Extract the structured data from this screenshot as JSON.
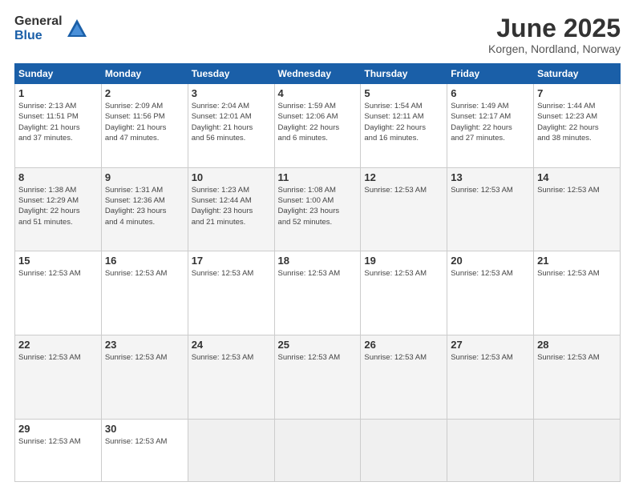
{
  "logo": {
    "general": "General",
    "blue": "Blue"
  },
  "title": "June 2025",
  "subtitle": "Korgen, Nordland, Norway",
  "days_of_week": [
    "Sunday",
    "Monday",
    "Tuesday",
    "Wednesday",
    "Thursday",
    "Friday",
    "Saturday"
  ],
  "weeks": [
    [
      {
        "day": "1",
        "info": "Sunrise: 2:13 AM\nSunset: 11:51 PM\nDaylight: 21 hours\nand 37 minutes."
      },
      {
        "day": "2",
        "info": "Sunrise: 2:09 AM\nSunset: 11:56 PM\nDaylight: 21 hours\nand 47 minutes."
      },
      {
        "day": "3",
        "info": "Sunrise: 2:04 AM\nSunset: 12:01 AM\nDaylight: 21 hours\nand 56 minutes."
      },
      {
        "day": "4",
        "info": "Sunrise: 1:59 AM\nSunset: 12:06 AM\nDaylight: 22 hours\nand 6 minutes."
      },
      {
        "day": "5",
        "info": "Sunrise: 1:54 AM\nSunset: 12:11 AM\nDaylight: 22 hours\nand 16 minutes."
      },
      {
        "day": "6",
        "info": "Sunrise: 1:49 AM\nSunset: 12:17 AM\nDaylight: 22 hours\nand 27 minutes."
      },
      {
        "day": "7",
        "info": "Sunrise: 1:44 AM\nSunset: 12:23 AM\nDaylight: 22 hours\nand 38 minutes."
      }
    ],
    [
      {
        "day": "8",
        "info": "Sunrise: 1:38 AM\nSunset: 12:29 AM\nDaylight: 22 hours\nand 51 minutes."
      },
      {
        "day": "9",
        "info": "Sunrise: 1:31 AM\nSunset: 12:36 AM\nDaylight: 23 hours\nand 4 minutes."
      },
      {
        "day": "10",
        "info": "Sunrise: 1:23 AM\nSunset: 12:44 AM\nDaylight: 23 hours\nand 21 minutes."
      },
      {
        "day": "11",
        "info": "Sunrise: 1:08 AM\nSunset: 1:00 AM\nDaylight: 23 hours\nand 52 minutes."
      },
      {
        "day": "12",
        "info": "Sunrise: 12:53 AM"
      },
      {
        "day": "13",
        "info": "Sunrise: 12:53 AM"
      },
      {
        "day": "14",
        "info": "Sunrise: 12:53 AM"
      }
    ],
    [
      {
        "day": "15",
        "info": "Sunrise: 12:53 AM"
      },
      {
        "day": "16",
        "info": "Sunrise: 12:53 AM"
      },
      {
        "day": "17",
        "info": "Sunrise: 12:53 AM"
      },
      {
        "day": "18",
        "info": "Sunrise: 12:53 AM"
      },
      {
        "day": "19",
        "info": "Sunrise: 12:53 AM"
      },
      {
        "day": "20",
        "info": "Sunrise: 12:53 AM"
      },
      {
        "day": "21",
        "info": "Sunrise: 12:53 AM"
      }
    ],
    [
      {
        "day": "22",
        "info": "Sunrise: 12:53 AM"
      },
      {
        "day": "23",
        "info": "Sunrise: 12:53 AM"
      },
      {
        "day": "24",
        "info": "Sunrise: 12:53 AM"
      },
      {
        "day": "25",
        "info": "Sunrise: 12:53 AM"
      },
      {
        "day": "26",
        "info": "Sunrise: 12:53 AM"
      },
      {
        "day": "27",
        "info": "Sunrise: 12:53 AM"
      },
      {
        "day": "28",
        "info": "Sunrise: 12:53 AM"
      }
    ],
    [
      {
        "day": "29",
        "info": "Sunrise: 12:53 AM"
      },
      {
        "day": "30",
        "info": "Sunrise: 12:53 AM"
      },
      {
        "day": "",
        "info": ""
      },
      {
        "day": "",
        "info": ""
      },
      {
        "day": "",
        "info": ""
      },
      {
        "day": "",
        "info": ""
      },
      {
        "day": "",
        "info": ""
      }
    ]
  ]
}
